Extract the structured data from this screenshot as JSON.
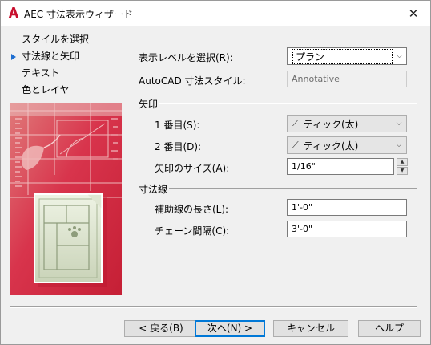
{
  "window": {
    "title": "AEC 寸法表示ウィザード",
    "close_glyph": "✕"
  },
  "steps": [
    {
      "label": "スタイルを選択",
      "current": false
    },
    {
      "label": "寸法線と矢印",
      "current": true
    },
    {
      "label": "テキスト",
      "current": false
    },
    {
      "label": "色とレイヤ",
      "current": false
    }
  ],
  "form": {
    "display_level_label": "表示レベルを選択(R):",
    "display_level_value": "プラン",
    "autocad_style_label": "AutoCAD 寸法スタイル:",
    "autocad_style_value": "Annotative",
    "arrows_section": "矢印",
    "first_label": "1 番目(S):",
    "first_value": "ティック(太)",
    "second_label": "2 番目(D):",
    "second_value": "ティック(太)",
    "arrow_size_label": "矢印のサイズ(A):",
    "arrow_size_value": "1/16\"",
    "dimline_section": "寸法線",
    "ext_length_label": "補助線の長さ(L):",
    "ext_length_value": "1'-0\"",
    "chain_spacing_label": "チェーン間隔(C):",
    "chain_spacing_value": "3'-0\""
  },
  "buttons": {
    "back": "< 戻る(B)",
    "next": "次へ(N) >",
    "cancel": "キャンセル",
    "help": "ヘルプ"
  },
  "icons": {
    "app": "autocad-a-icon",
    "close": "close-icon",
    "chevron": "chevron-down-icon",
    "tick": "tick-arrow-icon",
    "current_step": "triangle-right-icon"
  },
  "colors": {
    "accent": "#0078d7",
    "app_icon_red": "#c8102e",
    "art_red": "#d4233f",
    "step_marker": "#1f6fd1"
  }
}
